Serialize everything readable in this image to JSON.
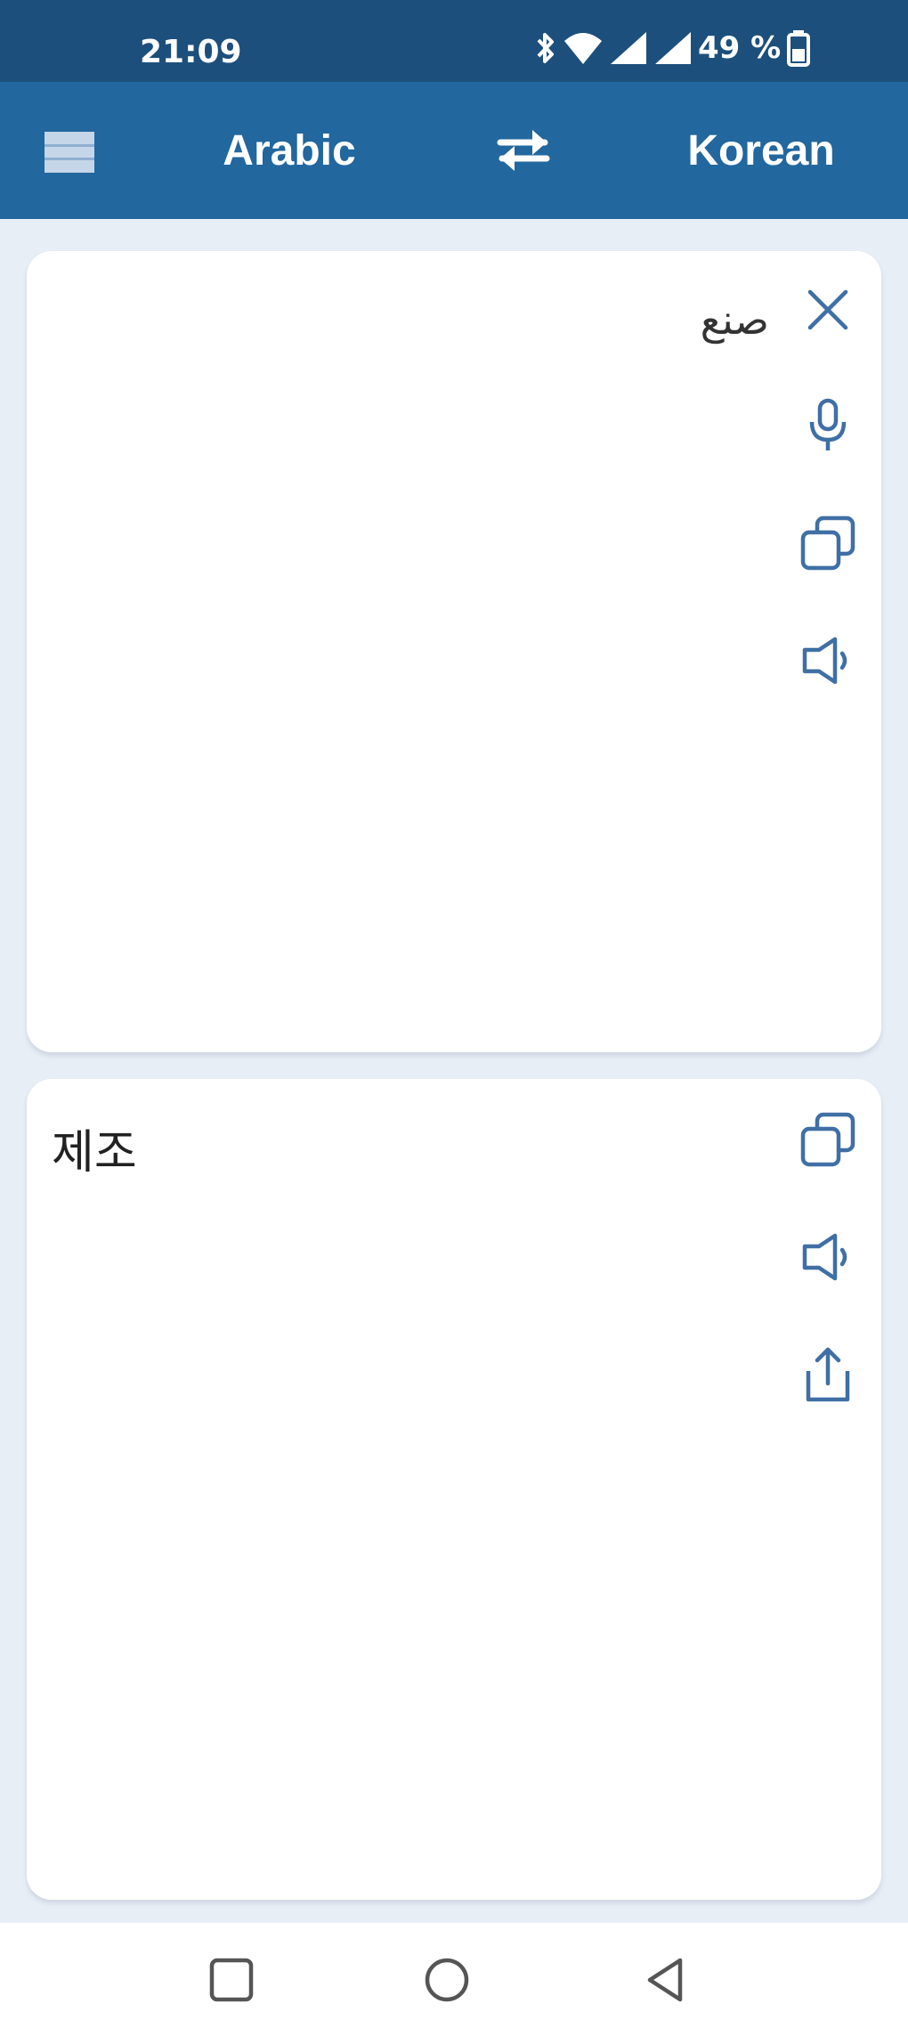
{
  "status_bar": {
    "time": "21:09",
    "battery": "49 %",
    "icons": [
      "bluetooth-icon",
      "wifi-icon",
      "signal-icon",
      "signal-icon",
      "battery-icon"
    ]
  },
  "app_bar": {
    "menu_icon": "menu-icon",
    "source_language": "Arabic",
    "swap_icon": "swap-icon",
    "target_language": "Korean"
  },
  "input_card": {
    "text": "صنع",
    "actions": [
      "close-icon",
      "microphone-icon",
      "copy-icon",
      "speaker-icon"
    ]
  },
  "output_card": {
    "text": "제조",
    "actions": [
      "copy-icon",
      "speaker-icon",
      "share-icon"
    ]
  },
  "nav_bar": {
    "buttons": [
      "recent-apps",
      "home",
      "back"
    ]
  },
  "colors": {
    "status_bar": "#1d4f7c",
    "app_bar": "#22679e",
    "background": "#e8eef6",
    "icon_accent": "#3f6fa5"
  }
}
